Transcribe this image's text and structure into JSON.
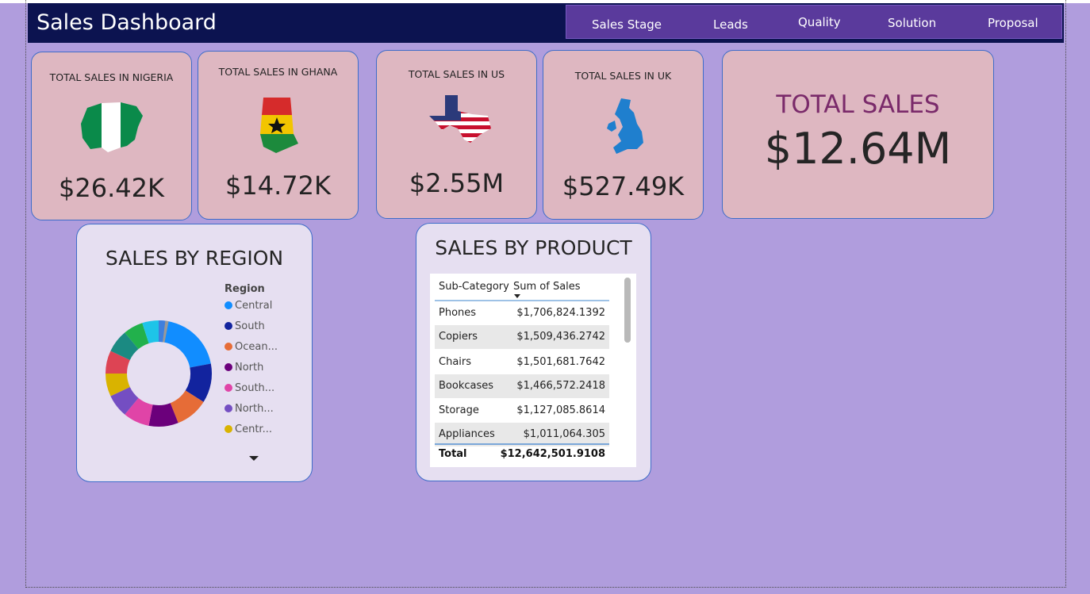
{
  "header": {
    "title": "Sales Dashboard",
    "nav": [
      "Sales Stage",
      "Leads",
      "Quality",
      "Solution",
      "Proposal"
    ]
  },
  "cards": {
    "nigeria": {
      "label": "TOTAL SALES IN NIGERIA",
      "value": "$26.42K",
      "icon": "nigeria-map-icon"
    },
    "ghana": {
      "label": "TOTAL SALES IN GHANA",
      "value": "$14.72K",
      "icon": "ghana-map-icon"
    },
    "us": {
      "label": "TOTAL SALES IN US",
      "value": "$2.55M",
      "icon": "texas-us-flag-map-icon"
    },
    "uk": {
      "label": "TOTAL SALES IN UK",
      "value": "$527.49K",
      "icon": "uk-map-icon"
    },
    "total": {
      "label": "TOTAL SALES",
      "value": "$12.64M"
    }
  },
  "region": {
    "title": "SALES BY REGION",
    "legend_title": "Region",
    "legend": [
      {
        "label": "Central",
        "color": "#118dff"
      },
      {
        "label": "South",
        "color": "#12239e"
      },
      {
        "label": "Ocean...",
        "color": "#e66c37"
      },
      {
        "label": "North",
        "color": "#6b007b"
      },
      {
        "label": "South...",
        "color": "#e044a7"
      },
      {
        "label": "North...",
        "color": "#744ec2"
      },
      {
        "label": "Centr...",
        "color": "#d9b300"
      }
    ]
  },
  "product": {
    "title": "SALES BY PRODUCT",
    "columns": [
      "Sub-Category",
      "Sum of Sales"
    ],
    "rows": [
      {
        "name": "Phones",
        "value": "$1,706,824.1392"
      },
      {
        "name": "Copiers",
        "value": "$1,509,436.2742"
      },
      {
        "name": "Chairs",
        "value": "$1,501,681.7642"
      },
      {
        "name": "Bookcases",
        "value": "$1,466,572.2418"
      },
      {
        "name": "Storage",
        "value": "$1,127,085.8614"
      },
      {
        "name": "Appliances",
        "value": "$1,011,064.305"
      }
    ],
    "total": {
      "name": "Total",
      "value": "$12,642,501.9108"
    }
  }
}
